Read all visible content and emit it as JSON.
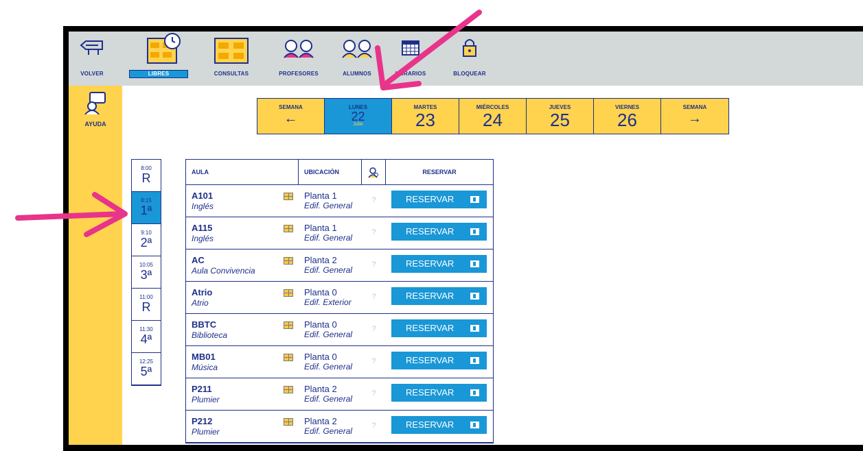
{
  "toolbar": {
    "items": [
      {
        "label": "VOLVER",
        "icon": "back-sign-icon"
      },
      {
        "label": "LIBRES",
        "icon": "free-rooms-clock-icon",
        "selected": true
      },
      {
        "label": "CONSULTAS",
        "icon": "rooms-icon"
      },
      {
        "label": "PROFESORES",
        "icon": "teachers-icon"
      },
      {
        "label": "ALUMNOS",
        "icon": "students-icon"
      },
      {
        "label": "HORARIOS",
        "icon": "calendar-icon"
      },
      {
        "label": "BLOQUEAR",
        "icon": "lock-icon"
      }
    ]
  },
  "sidebar": {
    "help_label": "AYUDA"
  },
  "days": [
    {
      "name": "SEMANA",
      "arrow": "←"
    },
    {
      "name": "LUNES",
      "date": "22",
      "month": "Julio",
      "selected": true
    },
    {
      "name": "MARTES",
      "date": "23"
    },
    {
      "name": "MIÉRCOLES",
      "date": "24"
    },
    {
      "name": "JUEVES",
      "date": "25"
    },
    {
      "name": "VIERNES",
      "date": "26"
    },
    {
      "name": "SEMANA",
      "arrow": "→"
    }
  ],
  "slots": [
    {
      "time": "8:00",
      "label": "R"
    },
    {
      "time": "8:15",
      "label": "1ª",
      "selected": true
    },
    {
      "time": "9:10",
      "label": "2ª"
    },
    {
      "time": "10:05",
      "label": "3ª"
    },
    {
      "time": "11:00",
      "label": "R"
    },
    {
      "time": "11:30",
      "label": "4ª"
    },
    {
      "time": "12:25",
      "label": "5ª"
    }
  ],
  "table": {
    "headers": {
      "aula": "AULA",
      "ubicacion": "UBICACIÓN",
      "reservar": "RESERVAR"
    },
    "rows": [
      {
        "code": "A101",
        "desc": "Inglés",
        "planta": "Planta 1",
        "edif": "Edif. General"
      },
      {
        "code": "A115",
        "desc": "Inglés",
        "planta": "Planta 1",
        "edif": "Edif. General"
      },
      {
        "code": "AC",
        "desc": "Aula Convivencia",
        "planta": "Planta 2",
        "edif": "Edif. General"
      },
      {
        "code": "Atrio",
        "desc": "Atrio",
        "planta": "Planta 0",
        "edif": "Edif. Exterior"
      },
      {
        "code": "BBTC",
        "desc": "Biblioteca",
        "planta": "Planta 0",
        "edif": "Edif. General"
      },
      {
        "code": "MB01",
        "desc": "Música",
        "planta": "Planta 0",
        "edif": "Edif. General"
      },
      {
        "code": "P211",
        "desc": "Plumier",
        "planta": "Planta 2",
        "edif": "Edif. General"
      },
      {
        "code": "P212",
        "desc": "Plumier",
        "planta": "Planta 2",
        "edif": "Edif. General"
      }
    ],
    "question_mark": "?",
    "button_label": "RESERVAR"
  },
  "colors": {
    "accent": "#1a97d6",
    "yellow": "#ffd34d",
    "navy": "#1e2f8a",
    "topbar": "#d3d8d8",
    "annotation": "#e8348a"
  }
}
